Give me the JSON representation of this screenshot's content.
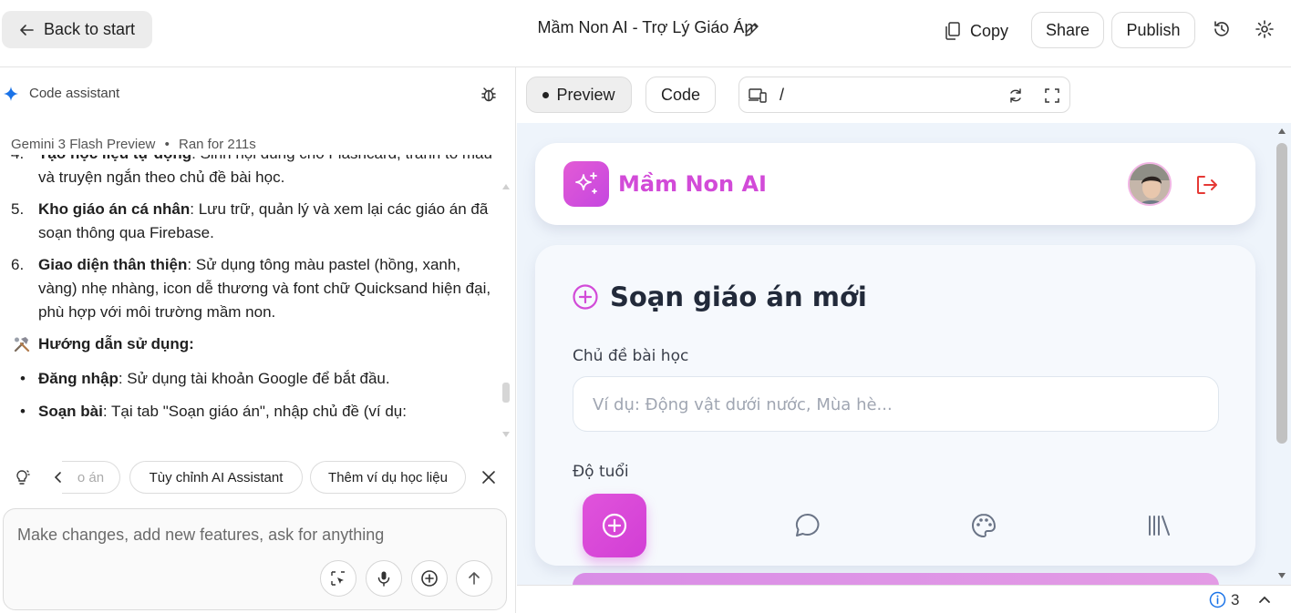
{
  "topbar": {
    "back_label": "Back to start",
    "title": "Mầm Non AI - Trợ Lý Giáo Án",
    "copy_label": "Copy",
    "share_label": "Share",
    "publish_label": "Publish"
  },
  "assistant": {
    "header": "Code assistant",
    "model": "Gemini 3 Flash Preview",
    "separator": "•",
    "ran_for": "Ran for 211s",
    "items": [
      {
        "num": "4.",
        "bold": "Tạo học liệu tự động",
        "text": ": Sinh nội dung cho Flashcard, tranh tô màu và truyện ngắn theo chủ đề bài học."
      },
      {
        "num": "5.",
        "bold": "Kho giáo án cá nhân",
        "text": ": Lưu trữ, quản lý và xem lại các giáo án đã soạn thông qua Firebase."
      },
      {
        "num": "6.",
        "bold": "Giao diện thân thiện",
        "text": ": Sử dụng tông màu pastel (hồng, xanh, vàng) nhẹ nhàng, icon dễ thương và font chữ Quicksand hiện đại, phù hợp với môi trường mầm non."
      }
    ],
    "guide_title": "Hướng dẫn sử dụng:",
    "bullets": [
      {
        "bold": "Đăng nhập",
        "text": ": Sử dụng tài khoản Google để bắt đầu."
      },
      {
        "bold": "Soạn bài",
        "text": ": Tại tab \"Soạn giáo án\", nhập chủ đề (ví dụ:"
      }
    ],
    "chips": [
      "o án",
      "Tùy chỉnh AI Assistant",
      "Thêm ví dụ học liệu"
    ],
    "input_placeholder": "Make changes, add new features, ask for anything"
  },
  "preview_bar": {
    "preview_label": "Preview",
    "code_label": "Code",
    "path": "/"
  },
  "app": {
    "brand": "Mầm Non AI",
    "section_title": "Soạn giáo án mới",
    "topic_label": "Chủ đề bài học",
    "topic_placeholder": "Ví dụ: Động vật dưới nước, Mùa hè...",
    "age_label": "Độ tuổi"
  },
  "footer": {
    "issues_count": "3"
  },
  "colors": {
    "accent_pink": "#d24bd8",
    "logout_red": "#e53935",
    "preview_bg": "#eef4fb"
  }
}
